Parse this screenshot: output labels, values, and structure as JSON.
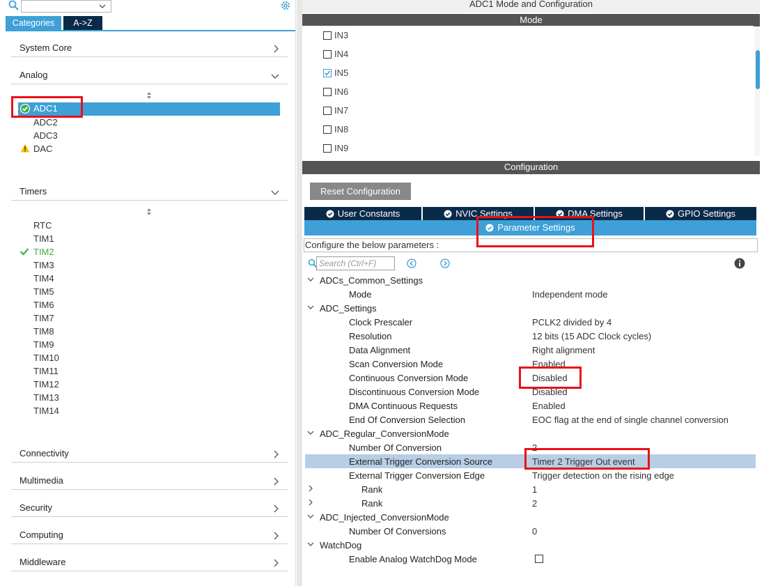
{
  "left": {
    "search_placeholder": "",
    "tabs": {
      "categories": "Categories",
      "az": "A->Z"
    },
    "categories": {
      "system_core": "System Core",
      "analog": "Analog",
      "timers": "Timers",
      "connectivity": "Connectivity",
      "multimedia": "Multimedia",
      "security": "Security",
      "computing": "Computing",
      "middleware": "Middleware"
    },
    "analog_items": [
      "ADC1",
      "ADC2",
      "ADC3",
      "DAC"
    ],
    "timer_items": [
      "RTC",
      "TIM1",
      "TIM2",
      "TIM3",
      "TIM4",
      "TIM5",
      "TIM6",
      "TIM7",
      "TIM8",
      "TIM9",
      "TIM10",
      "TIM11",
      "TIM12",
      "TIM13",
      "TIM14"
    ]
  },
  "right": {
    "title": "ADC1 Mode and Configuration",
    "mode_header": "Mode",
    "channels": [
      {
        "label": "IN3",
        "checked": false
      },
      {
        "label": "IN4",
        "checked": false
      },
      {
        "label": "IN5",
        "checked": true
      },
      {
        "label": "IN6",
        "checked": false
      },
      {
        "label": "IN7",
        "checked": false
      },
      {
        "label": "IN8",
        "checked": false
      },
      {
        "label": "IN9",
        "checked": false
      }
    ],
    "config_header": "Configuration",
    "reset_button": "Reset Configuration",
    "config_tabs": [
      "User Constants",
      "NVIC Settings",
      "DMA Settings",
      "GPIO Settings"
    ],
    "parameter_tab": "Parameter Settings",
    "hint": "Configure the below parameters :",
    "search_placeholder": "Search (Ctrl+F)",
    "params": {
      "g1": "ADCs_Common_Settings",
      "mode_name": "Mode",
      "mode_val": "Independent mode",
      "g2": "ADC_Settings",
      "clock_name": "Clock Prescaler",
      "clock_val": "PCLK2 divided by 4",
      "res_name": "Resolution",
      "res_val": "12 bits (15 ADC Clock cycles)",
      "align_name": "Data Alignment",
      "align_val": "Right alignment",
      "scan_name": "Scan Conversion Mode",
      "scan_val": "Enabled",
      "cont_name": "Continuous Conversion Mode",
      "cont_val": "Disabled",
      "disc_name": "Discontinuous Conversion Mode",
      "disc_val": "Disabled",
      "dma_name": "DMA Continuous Requests",
      "dma_val": "Enabled",
      "eoc_name": "End Of Conversion Selection",
      "eoc_val": "EOC flag at the end of single channel conversion",
      "g3": "ADC_Regular_ConversionMode",
      "num_name": "Number Of Conversion",
      "num_val": "2",
      "ext_src_name": "External Trigger Conversion Source",
      "ext_src_val": "Timer 2 Trigger Out event",
      "ext_edge_name": "External Trigger Conversion Edge",
      "ext_edge_val": "Trigger detection on the rising edge",
      "rank1_name": "Rank",
      "rank1_val": "1",
      "rank2_name": "Rank",
      "rank2_val": "2",
      "g4": "ADC_Injected_ConversionMode",
      "inj_name": "Number Of Conversions",
      "inj_val": "0",
      "g5": "WatchDog",
      "wd_name": "Enable Analog WatchDog Mode"
    }
  },
  "colors": {
    "accent": "#3ea0d7",
    "navy": "#0a2a4a",
    "annotation": "#e8111a",
    "ok_green": "#3fae49",
    "warn": "#f2c200"
  }
}
